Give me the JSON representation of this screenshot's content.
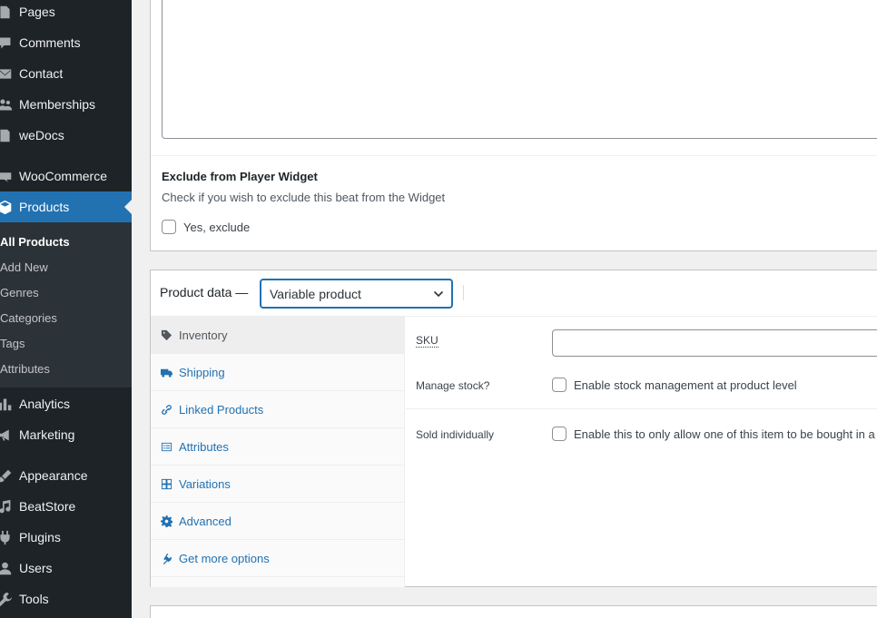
{
  "sidebar": {
    "items": [
      {
        "name": "pages",
        "label": "Pages",
        "icon": "pages-icon"
      },
      {
        "name": "comments",
        "label": "Comments",
        "icon": "comments-icon"
      },
      {
        "name": "contact",
        "label": "Contact",
        "icon": "mail-icon"
      },
      {
        "name": "memberships",
        "label": "Memberships",
        "icon": "groups-icon"
      },
      {
        "name": "wedocs",
        "label": "weDocs",
        "icon": "docs-icon"
      },
      {
        "name": "woocommerce",
        "label": "WooCommerce",
        "icon": "woo-icon"
      },
      {
        "name": "products",
        "label": "Products",
        "icon": "box-icon"
      },
      {
        "name": "analytics",
        "label": "Analytics",
        "icon": "chart-bar-icon"
      },
      {
        "name": "marketing",
        "label": "Marketing",
        "icon": "megaphone-icon"
      },
      {
        "name": "appearance",
        "label": "Appearance",
        "icon": "brush-icon"
      },
      {
        "name": "beatstore",
        "label": "BeatStore",
        "icon": "music-note-icon"
      },
      {
        "name": "plugins",
        "label": "Plugins",
        "icon": "plug-icon"
      },
      {
        "name": "users",
        "label": "Users",
        "icon": "users-icon"
      },
      {
        "name": "tools",
        "label": "Tools",
        "icon": "wrench-icon"
      }
    ],
    "active": "Products",
    "submenu": [
      {
        "label": "All Products",
        "current": true
      },
      {
        "label": "Add New"
      },
      {
        "label": "Genres"
      },
      {
        "label": "Categories"
      },
      {
        "label": "Tags"
      },
      {
        "label": "Attributes"
      }
    ]
  },
  "exclude_widget": {
    "title": "Exclude from Player Widget",
    "description": "Check if you wish to exclude this beat from the Widget",
    "checkbox_label": "Yes, exclude"
  },
  "product_data": {
    "title": "Product data —",
    "type_selected": "Variable product",
    "tabs": [
      {
        "label": "Inventory",
        "icon": "tag-icon",
        "active": true
      },
      {
        "label": "Shipping",
        "icon": "truck-icon"
      },
      {
        "label": "Linked Products",
        "icon": "link-icon"
      },
      {
        "label": "Attributes",
        "icon": "list-icon"
      },
      {
        "label": "Variations",
        "icon": "grid-icon"
      },
      {
        "label": "Advanced",
        "icon": "gear-icon"
      },
      {
        "label": "Get more options",
        "icon": "plugin-icon"
      }
    ],
    "inventory": {
      "sku_label": "SKU",
      "sku_value": "",
      "manage_stock_label": "Manage stock?",
      "manage_stock_checkbox": "Enable stock management at product level",
      "sold_individually_label": "Sold individually",
      "sold_individually_checkbox": "Enable this to only allow one of this item to be bought in a single order"
    }
  },
  "colors": {
    "sidebar_bg": "#1d2327",
    "submenu_bg": "#2c3338",
    "accent": "#2271b1",
    "page_bg": "#f0f0f1"
  }
}
